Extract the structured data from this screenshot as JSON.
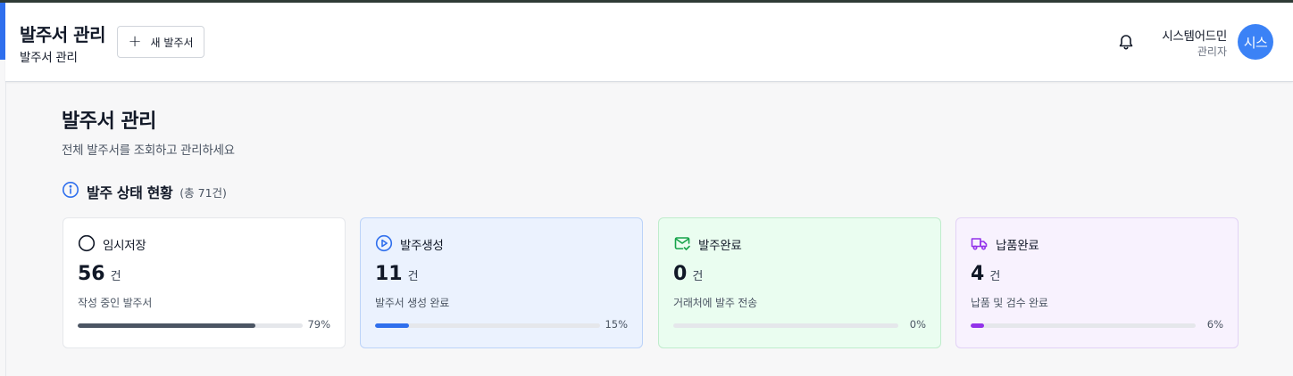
{
  "header": {
    "title": "발주서 관리",
    "subtitle": "발주서 관리",
    "new_button_label": "새 발주서",
    "user_name": "시스템어드민",
    "user_role": "관리자",
    "avatar_text": "시스"
  },
  "page": {
    "title": "발주서 관리",
    "description": "전체 발주서를 조회하고 관리하세요"
  },
  "section": {
    "title": "발주 상태 현황",
    "count": "(총 71건)"
  },
  "cards": [
    {
      "label": "임시저장",
      "value": "56",
      "unit": "건",
      "desc": "작성 중인 발주서",
      "percent": 79,
      "percent_label": "79%",
      "color": "#4b5563",
      "icon": "circle-icon"
    },
    {
      "label": "발주생성",
      "value": "11",
      "unit": "건",
      "desc": "발주서 생성 완료",
      "percent": 15,
      "percent_label": "15%",
      "color": "#2f6fed",
      "icon": "play-circle-icon"
    },
    {
      "label": "발주완료",
      "value": "0",
      "unit": "건",
      "desc": "거래처에 발주 전송",
      "percent": 0,
      "percent_label": "0%",
      "color": "#16a34a",
      "icon": "mail-check-icon"
    },
    {
      "label": "납품완료",
      "value": "4",
      "unit": "건",
      "desc": "납품 및 검수 완료",
      "percent": 6,
      "percent_label": "6%",
      "color": "#9333ea",
      "icon": "truck-icon"
    }
  ]
}
